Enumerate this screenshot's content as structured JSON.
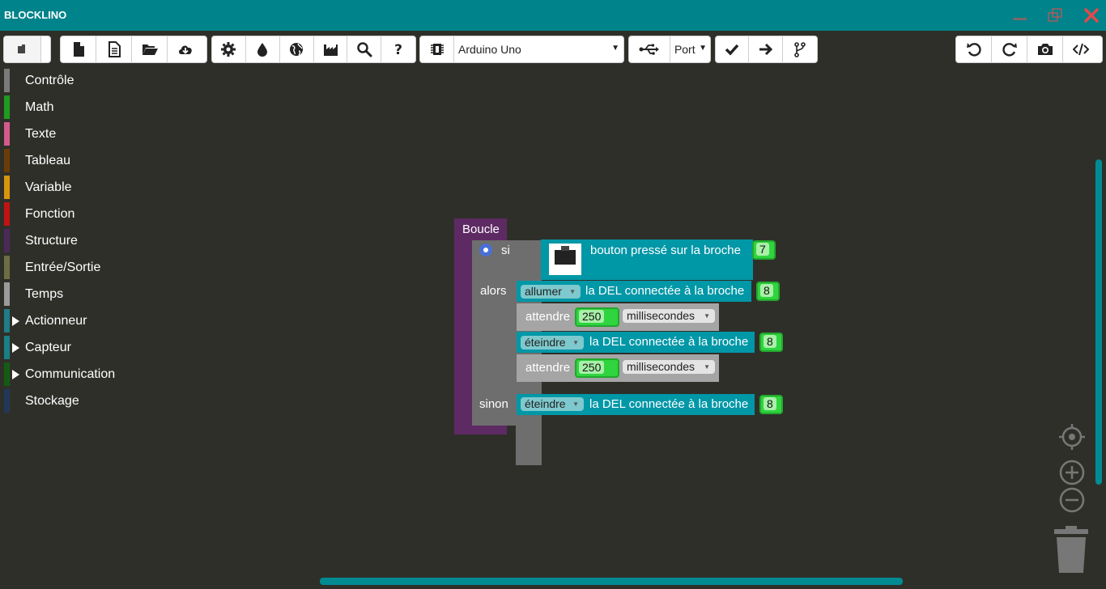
{
  "app": {
    "title": "BLOCKLINO"
  },
  "toolbar": {
    "board": "Arduino Uno",
    "port": "Port"
  },
  "toolbox": {
    "categories": [
      {
        "label": "Contrôle",
        "color": "#7a7a7a",
        "expandable": false
      },
      {
        "label": "Math",
        "color": "#1f9c1f",
        "expandable": false
      },
      {
        "label": "Texte",
        "color": "#d35b8c",
        "expandable": false
      },
      {
        "label": "Tableau",
        "color": "#6b3c08",
        "expandable": false
      },
      {
        "label": "Variable",
        "color": "#d7940d",
        "expandable": false
      },
      {
        "label": "Fonction",
        "color": "#c01414",
        "expandable": false
      },
      {
        "label": "Structure",
        "color": "#4b2a5a",
        "expandable": false
      },
      {
        "label": "Entrée/Sortie",
        "color": "#6e6e44",
        "expandable": false
      },
      {
        "label": "Temps",
        "color": "#9b9b9b",
        "expandable": false
      },
      {
        "label": "Actionneur",
        "color": "#1e7d86",
        "expandable": true
      },
      {
        "label": "Capteur",
        "color": "#1a7f86",
        "expandable": true
      },
      {
        "label": "Communication",
        "color": "#145c14",
        "expandable": true
      },
      {
        "label": "Stockage",
        "color": "#22385a",
        "expandable": false
      }
    ]
  },
  "workspace": {
    "loop_label": "Boucle",
    "if_label": "si",
    "then_label": "alors",
    "else_label": "sinon",
    "button_text": "bouton pressé sur la broche",
    "button_pin": "7",
    "on_action": "allumer",
    "led_text": "la DEL connectée à la broche",
    "led_pin_1": "8",
    "wait_label": "attendre",
    "wait_value": "250",
    "wait_unit": "millisecondes",
    "off_action": "éteindre",
    "led_pin_2": "8",
    "wait_value_2": "250",
    "wait_unit_2": "millisecondes",
    "off_action_else": "éteindre",
    "led_pin_3": "8"
  },
  "colors": {
    "titlebar": "#00838a",
    "workspace": "#2f2f2a",
    "block_teal": "#0097a7",
    "block_grey": "#a5a5a5",
    "block_purple": "#5e2a64",
    "number_green": "#2fd43e"
  }
}
